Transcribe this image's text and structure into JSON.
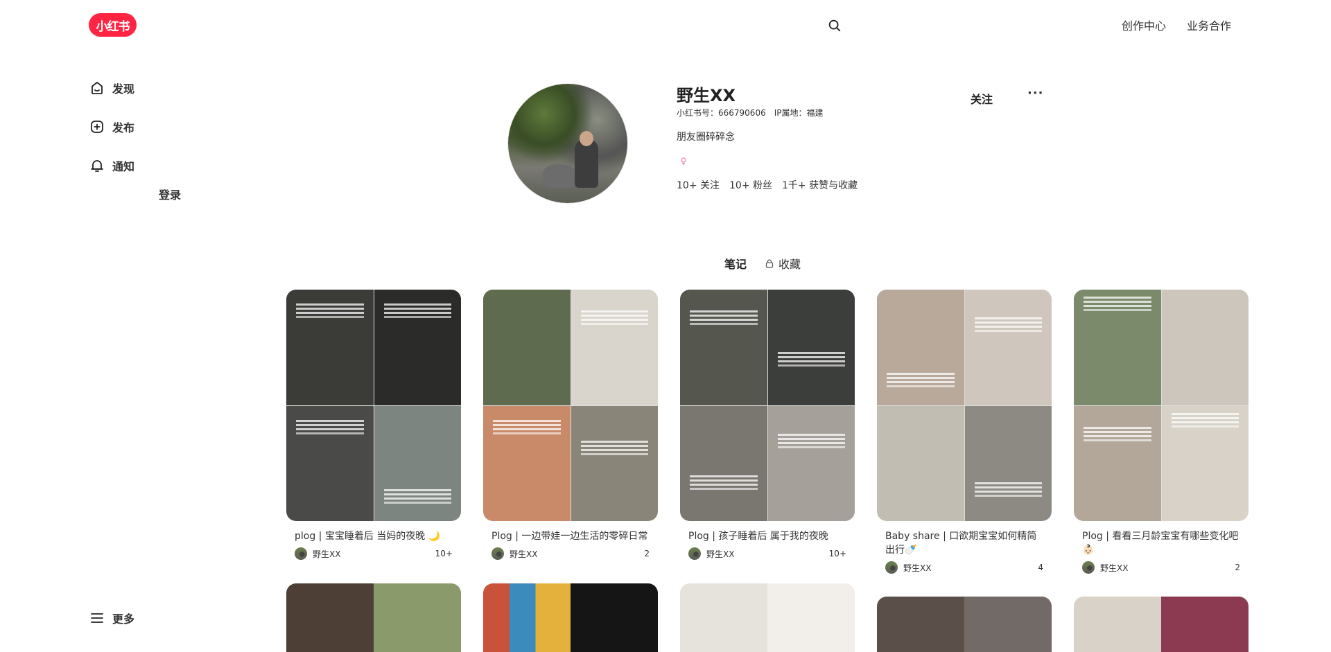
{
  "header": {
    "logo": "小红书",
    "links": [
      "创作中心",
      "业务合作"
    ]
  },
  "sidebar": {
    "items": [
      {
        "label": "发现",
        "icon": "home-icon"
      },
      {
        "label": "发布",
        "icon": "plus-square-icon"
      },
      {
        "label": "通知",
        "icon": "bell-icon"
      }
    ],
    "login": "登录",
    "more": "更多"
  },
  "profile": {
    "name": "野生XX",
    "id_label": "小红书号：666790606",
    "ip_label": "IP属地：福建",
    "bio": "朋友圈碎碎念",
    "stats": [
      {
        "value": "10+",
        "label": "关注"
      },
      {
        "value": "10+",
        "label": "粉丝"
      },
      {
        "value": "1千+",
        "label": "获赞与收藏"
      }
    ],
    "follow": "关注",
    "more": "···"
  },
  "tabs": [
    {
      "label": "笔记",
      "active": true
    },
    {
      "label": "收藏",
      "active": false,
      "icon": "lock-icon"
    }
  ],
  "notes": [
    {
      "title": "plog | 宝宝睡着后 当妈的夜晚 🌙",
      "author": "野生XX",
      "likes": "10+",
      "colors": [
        "#3b3b38",
        "#2a2a2a",
        "#444",
        "#7d8580"
      ]
    },
    {
      "title": "Plog | 一边带娃一边生活的零碎日常",
      "author": "野生XX",
      "likes": "2",
      "colors": [
        "#5f6b4f",
        "#d9d4cc",
        "#c98a6a",
        "#8a8579"
      ]
    },
    {
      "title": "Plog | 孩子睡着后 属于我的夜晚",
      "author": "野生XX",
      "likes": "10+",
      "colors": [
        "#55574f",
        "#3c3e3b",
        "#7a7670",
        "#a5a099"
      ]
    },
    {
      "title": "Baby share | 口欲期宝宝如何精简出行🍼",
      "author": "野生XX",
      "likes": "4",
      "colors": [
        "#b9a99a",
        "#cfc7bd",
        "#c2bdb2",
        "#8d8a83"
      ]
    },
    {
      "title": "Plog | 看看三月龄宝宝有哪些变化吧👶🏻",
      "author": "野生XX",
      "likes": "2",
      "colors": [
        "#7a8a6a",
        "#ccc6bd",
        "#b3a79a",
        "#d8d2c8"
      ]
    }
  ]
}
